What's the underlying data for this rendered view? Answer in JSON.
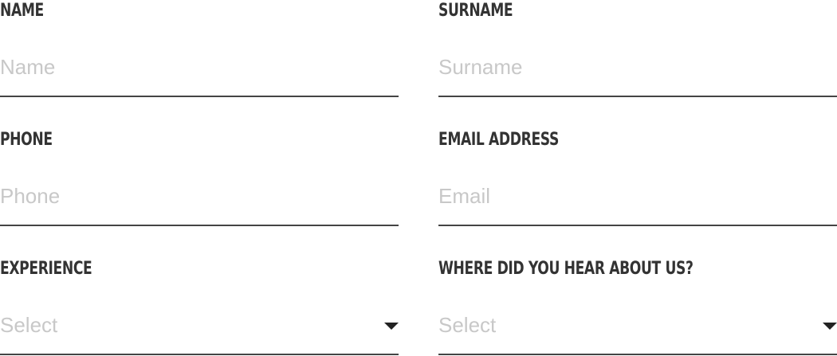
{
  "form": {
    "name": {
      "label": "NAME",
      "placeholder": "Name"
    },
    "surname": {
      "label": "SURNAME",
      "placeholder": "Surname"
    },
    "phone": {
      "label": "PHONE",
      "placeholder": "Phone"
    },
    "email": {
      "label": "EMAIL ADDRESS",
      "placeholder": "Email"
    },
    "experience": {
      "label": "EXPERIENCE",
      "selected": "Select",
      "icon": "caret-down-icon"
    },
    "source": {
      "label": "WHERE DID YOU HEAR ABOUT US?",
      "selected": "Select",
      "icon": "caret-down-icon"
    }
  },
  "colors": {
    "label": "#333333",
    "placeholder": "#c8c8c8",
    "underline": "#444444",
    "caret": "#222222"
  }
}
